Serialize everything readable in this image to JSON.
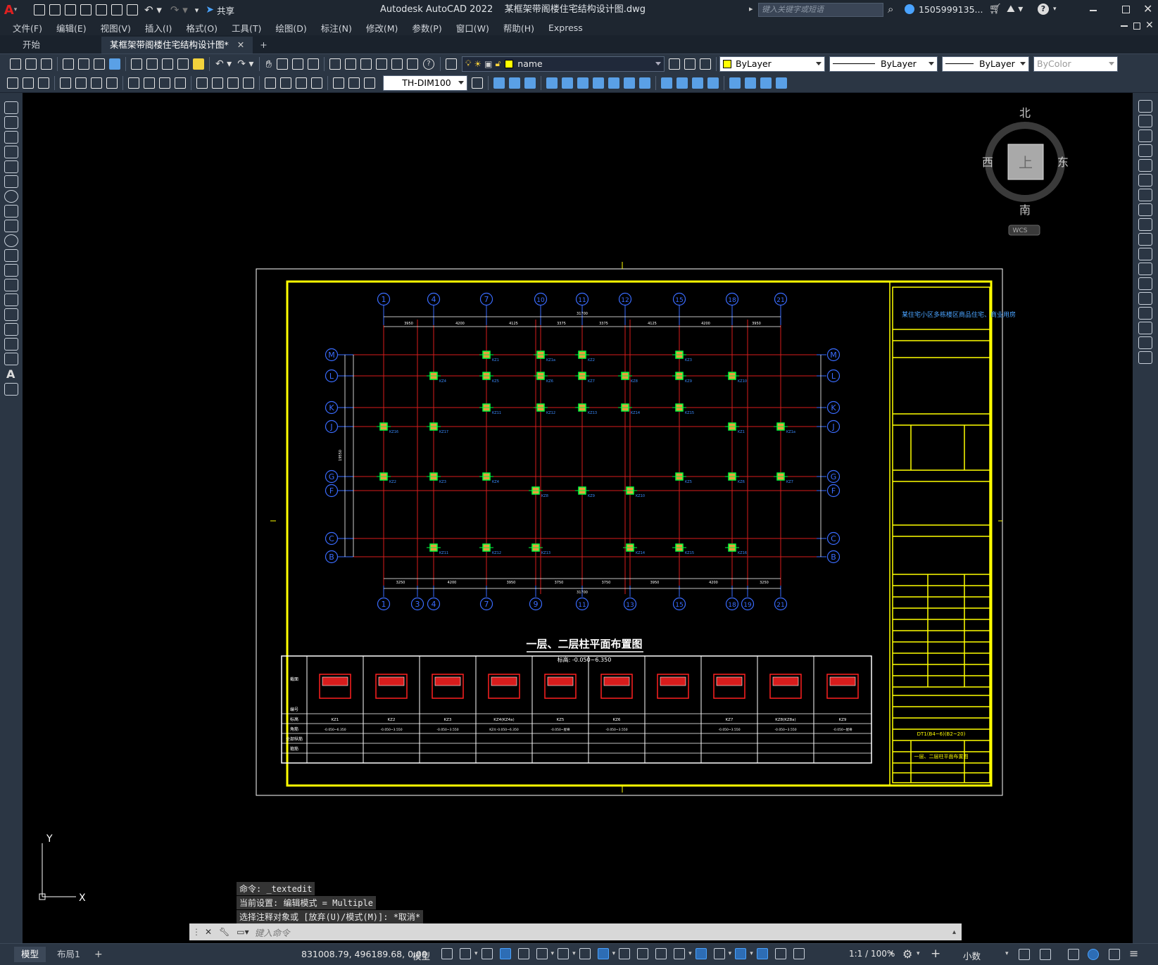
{
  "window": {
    "app_title": "Autodesk AutoCAD 2022",
    "doc_title": "某框架带阁楼住宅结构设计图.dwg",
    "share_label": "共享",
    "search_placeholder": "键入关键字或短语",
    "user_name": "1505999135..."
  },
  "menu": [
    "文件(F)",
    "编辑(E)",
    "视图(V)",
    "插入(I)",
    "格式(O)",
    "工具(T)",
    "绘图(D)",
    "标注(N)",
    "修改(M)",
    "参数(P)",
    "窗口(W)",
    "帮助(H)",
    "Express"
  ],
  "tabs": {
    "start": "开始",
    "doc": "某框架带阁楼住宅结构设计图*"
  },
  "properties": {
    "layer_name": "name",
    "color": "ByLayer",
    "linetype": "ByLayer",
    "lineweight": "ByLayer",
    "plotstyle": "ByColor",
    "dimstyle": "TH-DIM100"
  },
  "viewcube": {
    "north": "北",
    "south": "南",
    "east": "东",
    "west": "西",
    "face": "上",
    "wcs": "WCS"
  },
  "drawing": {
    "plan_title": "一层、二层柱平面布置图",
    "plan_subtitle": "标高: -0.050~6.350",
    "project_text": "某住宅小区多栋楼区商品住宅、商业用房",
    "top_grid_labels": [
      "1",
      "4",
      "7",
      "10",
      "11",
      "12",
      "15",
      "18",
      "21"
    ],
    "bottom_grid_labels": [
      "1",
      "3",
      "4",
      "7",
      "9",
      "11",
      "13",
      "15",
      "18",
      "19",
      "21"
    ],
    "row_labels": [
      "M",
      "L",
      "K",
      "J",
      "G",
      "F",
      "C",
      "B"
    ],
    "top_dims": [
      "3950",
      "4200",
      "4125",
      "3375",
      "3375",
      "4125",
      "4200",
      "3950"
    ],
    "top_total": "31700",
    "bottom_dims": [
      "3250",
      "4200",
      "3950",
      "3750",
      "3750",
      "3950",
      "4200",
      "3250"
    ],
    "bottom_total": "31700",
    "left_total": "19550",
    "column_tags": [
      "KZ1",
      "KZ1a",
      "KZ2",
      "KZ3",
      "KZ4",
      "KZ5",
      "KZ6",
      "KZ7",
      "KZ8",
      "KZ9",
      "KZ10",
      "KZ11",
      "KZ12",
      "KZ13",
      "KZ14",
      "KZ15",
      "KZ16",
      "KZ17"
    ],
    "schedule_headers": [
      "截面",
      "编号",
      "标高",
      "角筋",
      "全部纵筋",
      "箍筋"
    ],
    "schedule_cols": [
      "KZ1",
      "KZ2",
      "KZ3",
      "KZ4(KZ4a)",
      "KZ5",
      "KZ6",
      "KZ7",
      "KZ8(KZ8a)",
      "KZ9"
    ],
    "schedule_elev": [
      "-0.050~6.350",
      "-0.050~3.550",
      "-0.050~3.550",
      "KZ4:-0.050~6.350",
      "-0.050~屋脊",
      "-0.050~3.550",
      "-0.050~3.550",
      "-0.050~3.550",
      "-0.050~屋脊"
    ],
    "titleblock_drawing_name": "一层、二层柱平面布置图",
    "titleblock_code": "DT1(B4~6)(B2~20)"
  },
  "command_history": [
    "命令: _textedit",
    "当前设置: 编辑模式 = Multiple",
    "选择注释对象或 [放弃(U)/模式(M)]: *取消*"
  ],
  "command_placeholder": "键入命令",
  "status": {
    "model_tab": "模型",
    "layout_tab": "布局1",
    "coords": "831008.79, 496189.68, 0.00",
    "space": "模型",
    "scale": "1:1 / 100%",
    "units": "小数"
  },
  "ucs": {
    "x_label": "X",
    "y_label": "Y"
  },
  "colors": {
    "frame_yellow": "#ffff00",
    "grid_red": "#ff2020",
    "grid_blue": "#2f6bff",
    "column_green": "#00ff3c",
    "accent_blue": "#4aa3ff"
  }
}
